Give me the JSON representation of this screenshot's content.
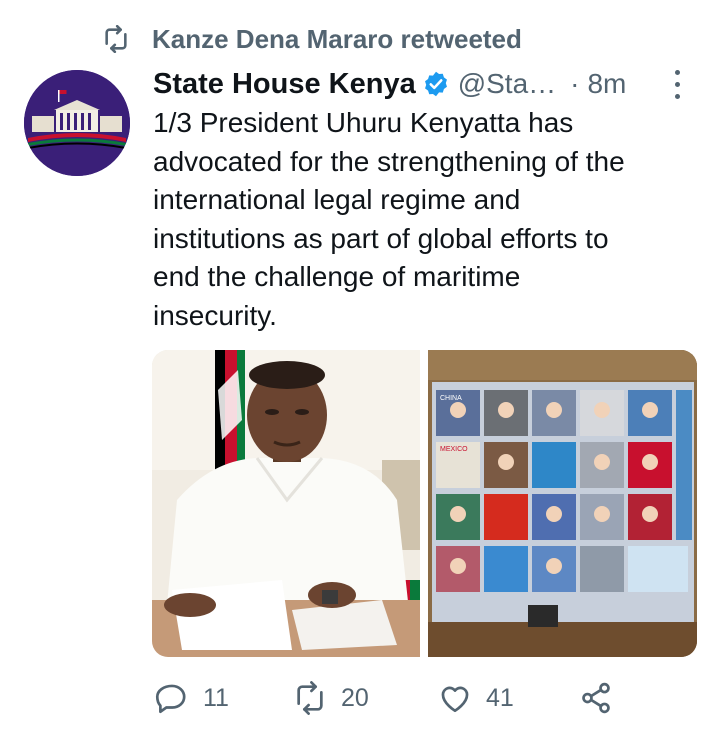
{
  "retweet": {
    "label": "Kanze Dena Mararo retweeted"
  },
  "tweet": {
    "display_name": "State House Kenya",
    "handle": "@Sta…",
    "separator": "·",
    "time": "8m",
    "text": "1/3 President Uhuru Kenyatta has\nadvocated for the strengthening of the\ninternational legal regime and\ninstitutions as part of global efforts to\nend the challenge of maritime\ninsecurity."
  },
  "avatar": {
    "caption": "@StateHouseKenya"
  },
  "photo2": {
    "tile_label_1": "CHINA",
    "tile_label_2": "MEXICO"
  },
  "actions": {
    "replies": "11",
    "retweets": "20",
    "likes": "41"
  },
  "colors": {
    "text": "#0f1419",
    "secondary": "#536471",
    "verified": "#1d9bf0",
    "avatar_bg": "#3a1f78"
  },
  "icons": [
    "retweet-icon",
    "verified-badge-icon",
    "more-icon",
    "reply-icon",
    "like-icon",
    "share-icon"
  ]
}
